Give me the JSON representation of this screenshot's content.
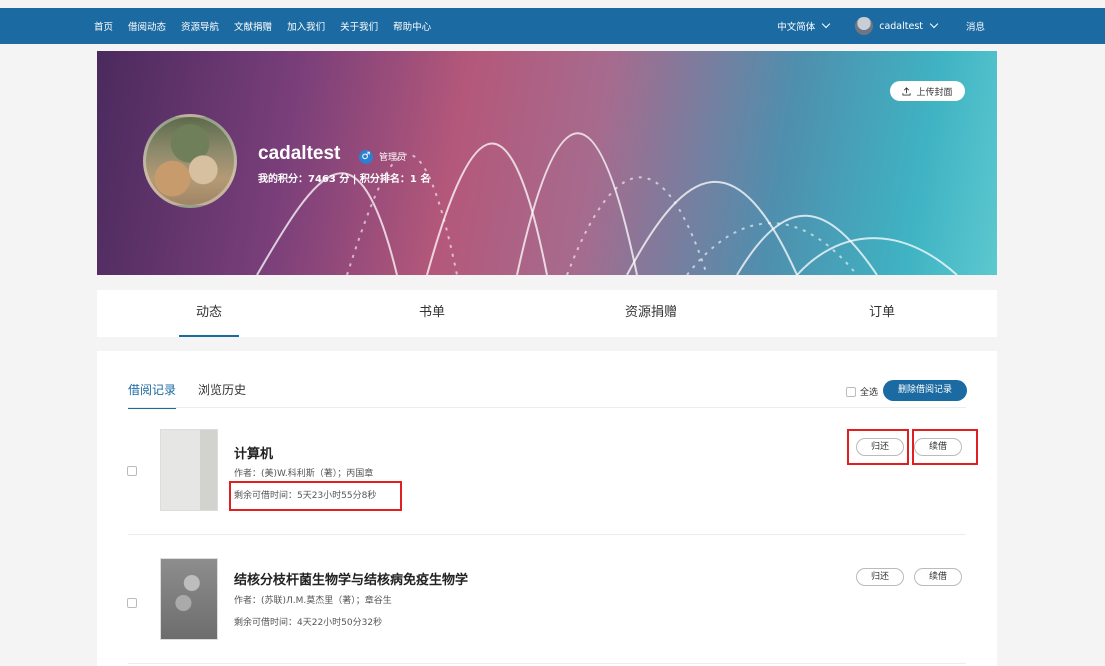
{
  "nav": {
    "links": [
      "首页",
      "借阅动态",
      "资源导航",
      "文献捐赠",
      "加入我们",
      "关于我们",
      "帮助中心"
    ],
    "language": "中文简体",
    "username": "cadaltest",
    "messages": "消息"
  },
  "profile": {
    "upload_cover": "上传封面",
    "username": "cadaltest",
    "gender_symbol": "♂",
    "role": "管理员",
    "score_line": "我的积分：7463 分 | 积分排名：1 名"
  },
  "main_tabs": [
    "动态",
    "书单",
    "资源捐赠",
    "订单"
  ],
  "borrow": {
    "sub_tabs": [
      "借阅记录",
      "浏览历史"
    ],
    "select_all": "全选",
    "delete_button": "删除借阅记录",
    "return_label": "归还",
    "renew_label": "续借",
    "items": [
      {
        "title": "计算机",
        "author": "作者：(美)W.科利斯（著）；丙国章",
        "remaining": "剩余可借时间：5天23小时55分8秒"
      },
      {
        "title": "结核分枝杆菌生物学与结核病免疫生物学",
        "author": "作者：(苏联)Л.М.莫杰里（著）；章谷生",
        "remaining": "剩余可借时间：4天22小时50分32秒"
      }
    ]
  },
  "colors": {
    "primary": "#1b6aa1",
    "highlight": "#e02020"
  }
}
